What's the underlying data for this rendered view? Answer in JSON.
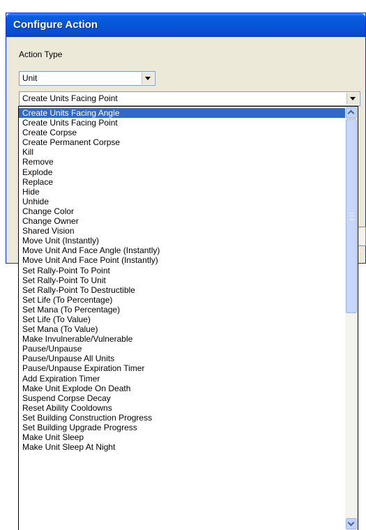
{
  "window": {
    "title": "Configure Action"
  },
  "form": {
    "action_type_label": "Action Type",
    "category_value": "Unit",
    "action_value": "Create Units Facing Point"
  },
  "dropdown": {
    "selected_index": 0,
    "items": [
      "Create Units Facing Angle",
      "Create Units Facing Point",
      "Create Corpse",
      "Create Permanent Corpse",
      "Kill",
      "Remove",
      "Explode",
      "Replace",
      "Hide",
      "Unhide",
      "Change Color",
      "Change Owner",
      "Shared Vision",
      "Move Unit (Instantly)",
      "Move Unit And Face Angle (Instantly)",
      "Move Unit And Face Point (Instantly)",
      "Set Rally-Point To Point",
      "Set Rally-Point To Unit",
      "Set Rally-Point To Destructible",
      "Set Life (To Percentage)",
      "Set Mana (To Percentage)",
      "Set Life (To Value)",
      "Set Mana (To Value)",
      "Make Invulnerable/Vulnerable",
      "Pause/Unpause",
      "Pause/Unpause All Units",
      "Pause/Unpause Expiration Timer",
      "Add Expiration Timer",
      "Make Unit Explode On Death",
      "Suspend Corpse Decay",
      "Reset Ability Cooldowns",
      "Set Building Construction Progress",
      "Set Building Upgrade Progress",
      "Make Unit Sleep",
      "Make Unit Sleep At Night"
    ]
  },
  "colors": {
    "selection": "#316ac5",
    "titlebar": "#0654d8",
    "dialog_bg": "#ece9d8"
  }
}
